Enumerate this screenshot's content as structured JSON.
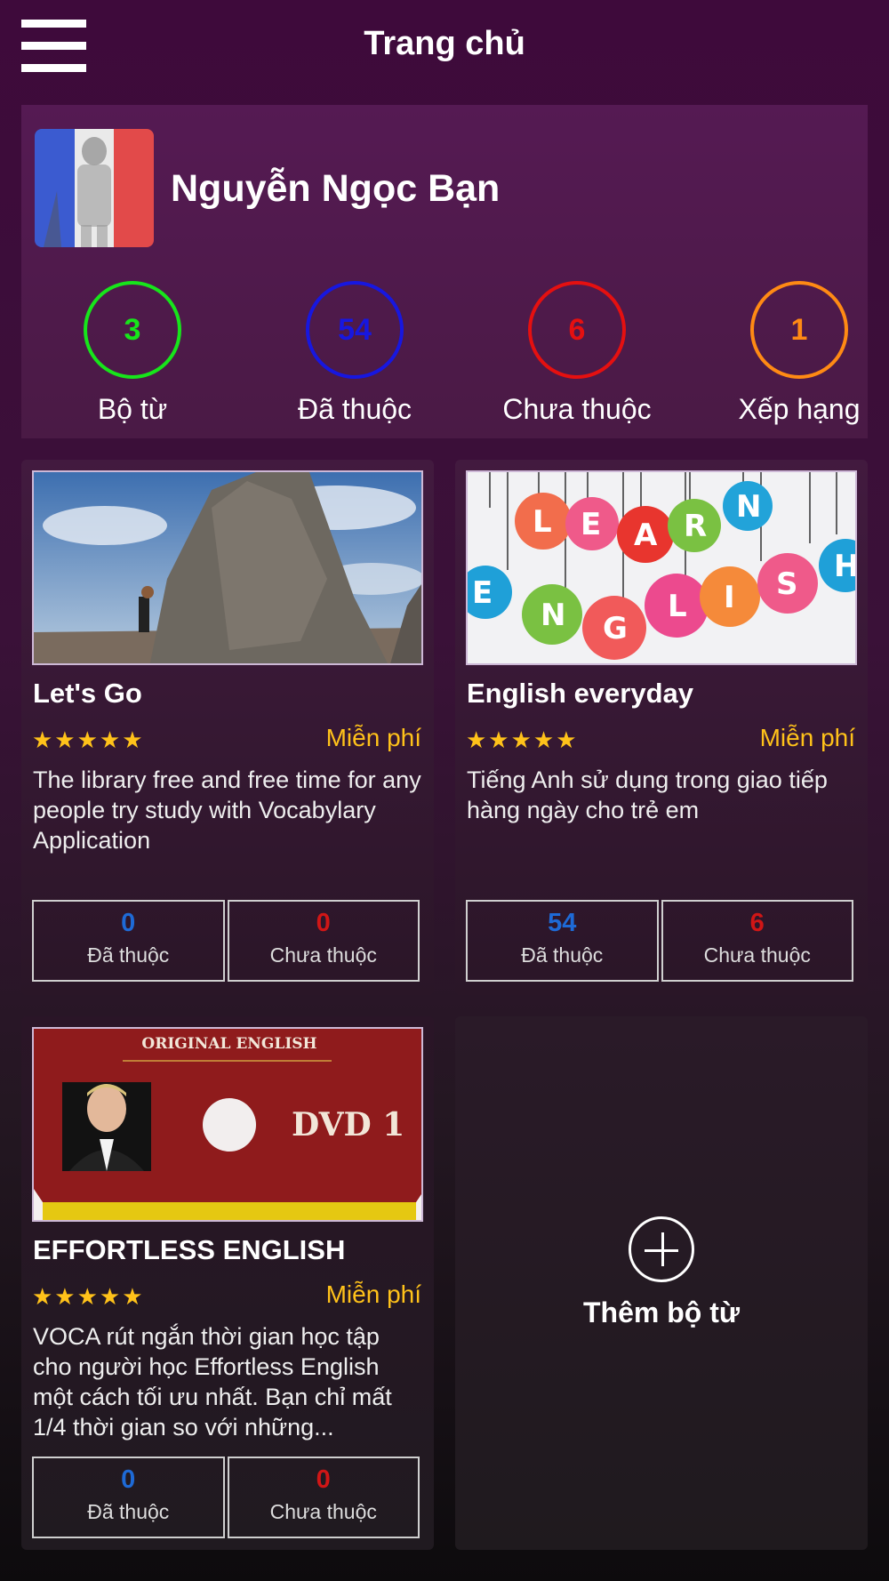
{
  "header": {
    "title": "Trang chủ"
  },
  "profile": {
    "name": "Nguyễn Ngọc Bạn",
    "stats": [
      {
        "value": "3",
        "label": "Bộ từ",
        "color": "#17e51b"
      },
      {
        "value": "54",
        "label": "Đã thuộc",
        "color": "#1717e0"
      },
      {
        "value": "6",
        "label": "Chưa thuộc",
        "color": "#e51010"
      },
      {
        "value": "1",
        "label": "Xếp hạng",
        "color": "#ff8a14"
      }
    ]
  },
  "cards": [
    {
      "title": "Let's Go",
      "stars": "★★★★★",
      "price": "Miễn phí",
      "description": "The library free and free time for any people try study with Vocabylary Application",
      "learned_value": "0",
      "learned_label": "Đã thuộc",
      "unlearned_value": "0",
      "unlearned_label": "Chưa thuộc",
      "image": "rock-climber-image"
    },
    {
      "title": "English everyday",
      "stars": "★★★★★",
      "price": "Miễn phí",
      "description": "Tiếng Anh sử dụng trong giao tiếp hàng ngày cho trẻ em",
      "learned_value": "54",
      "learned_label": "Đã thuộc",
      "unlearned_value": "6",
      "unlearned_label": "Chưa thuộc",
      "image": "learn-english-bubbles-image",
      "image_text": [
        "L",
        "E",
        "A",
        "R",
        "N",
        "E",
        "N",
        "G",
        "L",
        "I",
        "S",
        "H"
      ]
    },
    {
      "title": "EFFORTLESS ENGLISH",
      "stars": "★★★★★",
      "price": "Miễn phí",
      "description": "VOCA rút ngắn thời gian học tập cho người học Effortless English một cách tối ưu nhất. Bạn chỉ mất 1/4 thời gian so với những...",
      "learned_value": "0",
      "learned_label": "Đã thuộc",
      "unlearned_value": "0",
      "unlearned_label": "Chưa thuộc",
      "image": "dvd-cover-image",
      "image_text": {
        "top": "ORIGINAL ENGLISH",
        "dvd": "DVD 1"
      }
    }
  ],
  "add_set": {
    "label": "Thêm bộ từ"
  }
}
